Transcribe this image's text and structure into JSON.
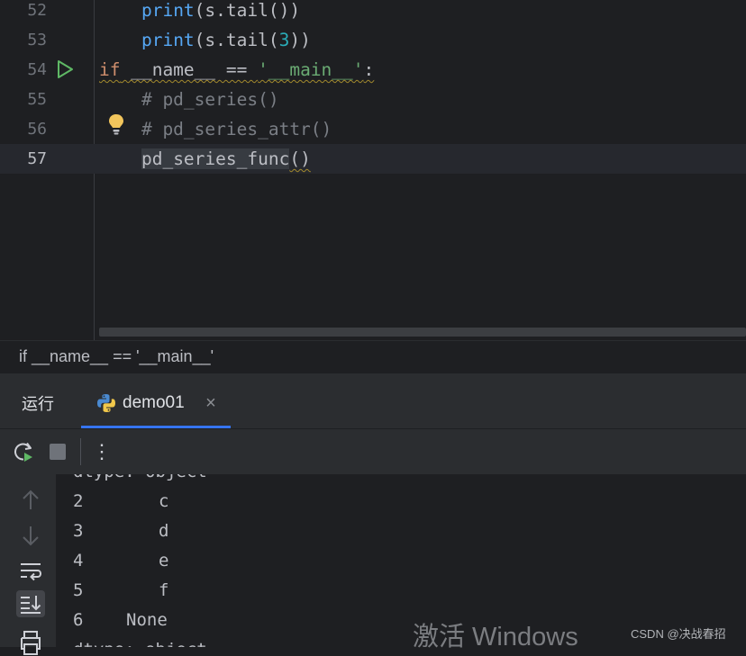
{
  "editor": {
    "lines": [
      {
        "num": "52",
        "indent": "    ",
        "call": "print",
        "open": "(s.tail())",
        "arg": "",
        "close": ""
      },
      {
        "num": "53",
        "indent": "    ",
        "call": "print",
        "open": "(s.tail(",
        "arg": "3",
        "close": "))"
      },
      {
        "num": "54",
        "kw": "if",
        "name_part": " __name__ == ",
        "str": "'__main__'",
        "colon": ":"
      },
      {
        "num": "55",
        "comment": "    # pd_series()"
      },
      {
        "num": "56",
        "comment": "    # pd_series_attr()"
      },
      {
        "num": "57",
        "indent": "    ",
        "func": "pd_series_func",
        "parens": "()"
      }
    ]
  },
  "breadcrumb": {
    "text": "if __name__ == '__main__'"
  },
  "run_panel": {
    "title": "运行",
    "tab": {
      "label": "demo01",
      "close": "×"
    },
    "toolbar": {
      "more": "⋮"
    }
  },
  "console": {
    "partial_top": "dtype: object",
    "rows": [
      {
        "index": "2",
        "value": "c"
      },
      {
        "index": "3",
        "value": "d"
      },
      {
        "index": "4",
        "value": "e"
      },
      {
        "index": "5",
        "value": "f"
      },
      {
        "index": "6",
        "value": "None"
      }
    ],
    "partial_bottom": "dtype: object"
  },
  "overlay": {
    "watermark": "激活 Windows",
    "credit": "CSDN @决战春招"
  },
  "colors": {
    "keyword": "#cf8e6d",
    "function": "#56a8f5",
    "number": "#2aacb8",
    "string": "#6aab73",
    "comment": "#7a7e85",
    "accent": "#3574f0"
  },
  "icons": [
    "run-gutter-icon",
    "bulb-icon",
    "python-icon",
    "rerun-icon",
    "stop-icon",
    "more-icon",
    "scroll-up-icon",
    "scroll-down-icon",
    "soft-wrap-icon",
    "scroll-to-end-icon",
    "print-icon"
  ]
}
